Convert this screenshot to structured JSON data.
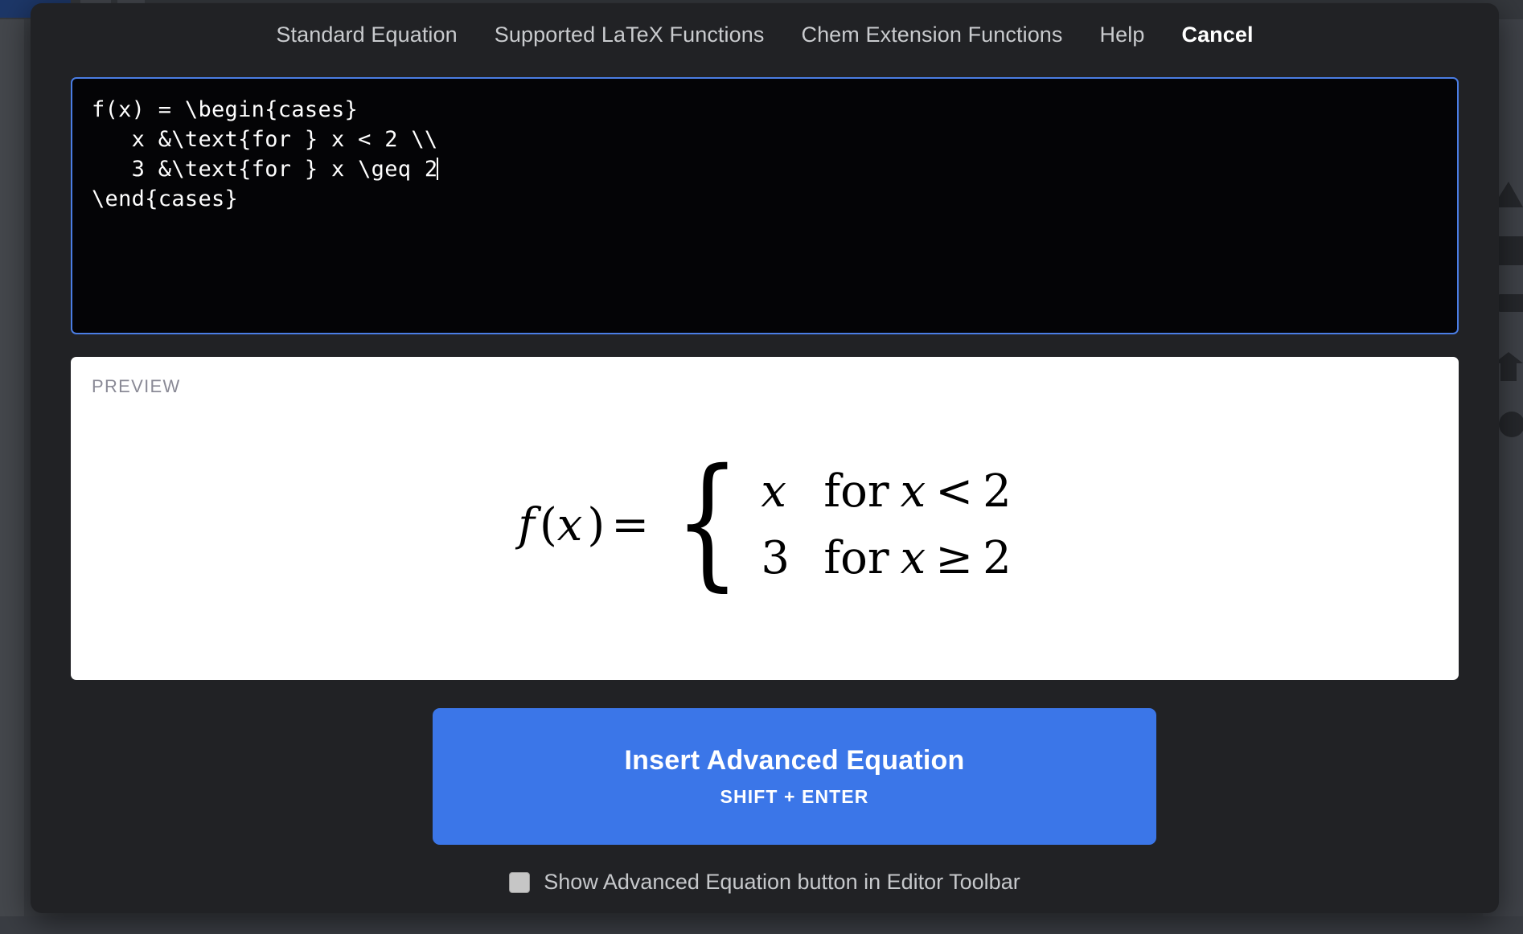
{
  "header": {
    "items": [
      {
        "label": "Standard Equation",
        "emphasis": false
      },
      {
        "label": "Supported LaTeX Functions",
        "emphasis": false
      },
      {
        "label": "Chem Extension Functions",
        "emphasis": false
      },
      {
        "label": "Help",
        "emphasis": false
      },
      {
        "label": "Cancel",
        "emphasis": true
      }
    ]
  },
  "editor": {
    "value_line1": "f(x) = \\begin{cases}",
    "value_line2": "   x &\\text{for } x < 2 \\\\",
    "value_line3": "   3 &\\text{for } x \\geq 2",
    "value_line4": "\\end{cases}",
    "border_color": "#4a7de4",
    "background_color": "#040406"
  },
  "preview": {
    "label": "PREVIEW",
    "math": {
      "lhs": "f",
      "lhs_arg_open": "(",
      "lhs_arg": "x",
      "lhs_arg_close": ")",
      "equals": "=",
      "brace": "{",
      "cases": [
        {
          "value": "x",
          "value_italic": true,
          "cond_text": "for",
          "cond_var": "x",
          "cond_rel": "<",
          "cond_num": "2"
        },
        {
          "value": "3",
          "value_italic": false,
          "cond_text": "for",
          "cond_var": "x",
          "cond_rel": "≥",
          "cond_num": "2"
        }
      ]
    }
  },
  "actions": {
    "insert_label": "Insert Advanced Equation",
    "insert_shortcut": "SHIFT + ENTER",
    "insert_color": "#3b76e8"
  },
  "footer": {
    "checkbox_label": "Show Advanced Equation button in Editor Toolbar",
    "checkbox_checked": false
  }
}
